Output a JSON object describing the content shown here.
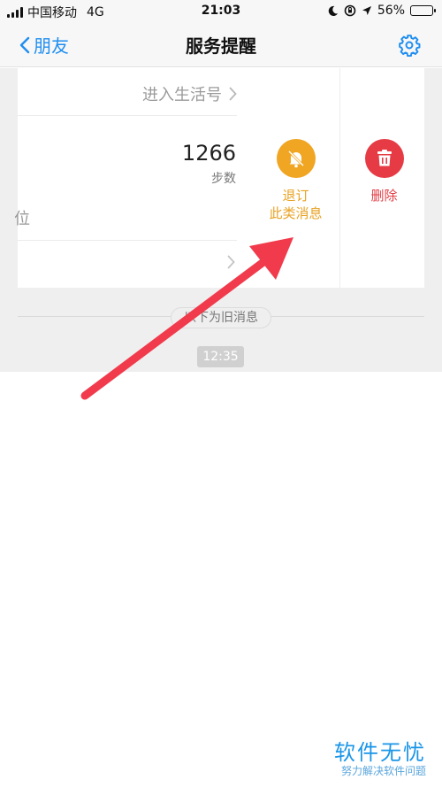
{
  "statusbar": {
    "carrier": "中国移动",
    "network": "4G",
    "time": "21:03",
    "battery": "56%",
    "battery_level": 0.56
  },
  "navbar": {
    "back_label": "朋友",
    "title": "服务提醒"
  },
  "card": {
    "enter_link": "进入生活号",
    "steps_count": "1266",
    "steps_label": "步数",
    "rank_fragment": "位"
  },
  "actions": {
    "unsubscribe_line1": "退订",
    "unsubscribe_line2": "此类消息",
    "delete_label": "删除"
  },
  "divider": {
    "old_messages_label": "以下为旧消息"
  },
  "timestamp": "12:35",
  "watermark": {
    "title": "软件无忧",
    "subtitle": "努力解决软件问题"
  },
  "colors": {
    "accent": "#1f8ef0",
    "unsubscribe": "#f0a523",
    "delete": "#e63b45",
    "arrow": "#f13a4b"
  }
}
